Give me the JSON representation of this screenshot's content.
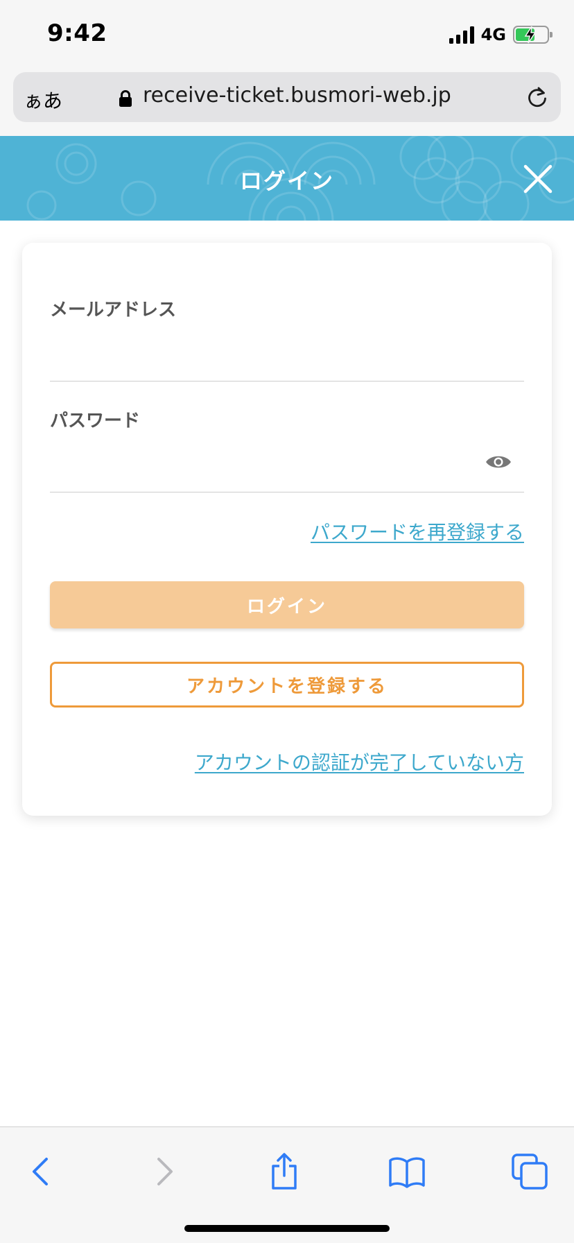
{
  "status_bar": {
    "time": "9:42",
    "network": "4G",
    "battery_level": 0.56,
    "battery_charging": true
  },
  "browser": {
    "text_size_label": "ぁあ",
    "url": "receive-ticket.busmori-web.jp",
    "lock_icon": "lock-icon",
    "reload_icon": "reload-icon"
  },
  "header": {
    "title": "ログイン",
    "close_icon": "close-icon",
    "color": "#4fb3d5"
  },
  "form": {
    "email_label": "メールアドレス",
    "email_value": "",
    "password_label": "パスワード",
    "password_value": "",
    "show_password_icon": "eye-icon",
    "reset_password_link": "パスワードを再登録する",
    "login_button": "ログイン",
    "register_button": "アカウントを登録する",
    "unverified_link": "アカウントの認証が完了していない方"
  },
  "colors": {
    "accent_orange": "#ee9a3a",
    "disabled_orange": "#f6ca97",
    "link_blue": "#3da8cc"
  },
  "toolbar": {
    "items": [
      "back-icon",
      "forward-icon",
      "share-icon",
      "bookmarks-icon",
      "tabs-icon"
    ]
  }
}
